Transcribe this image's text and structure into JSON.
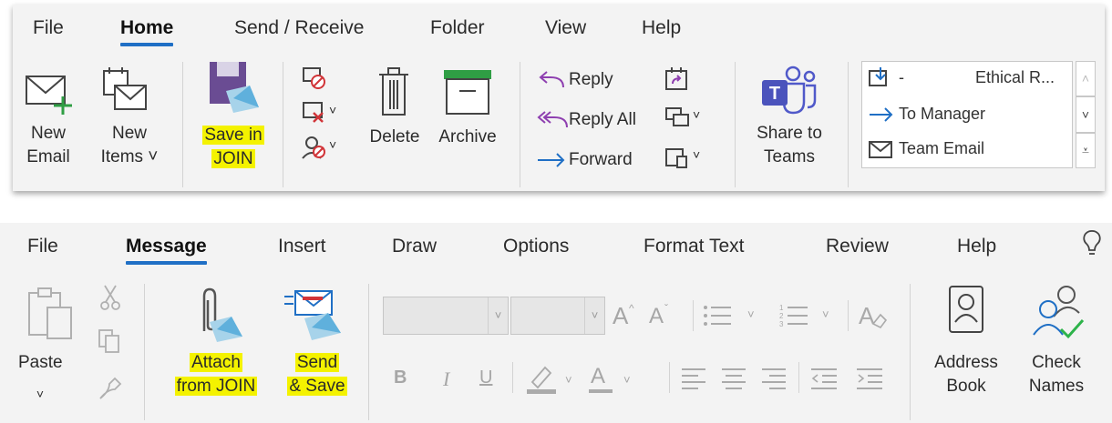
{
  "ribbon_top": {
    "tabs": [
      "File",
      "Home",
      "Send / Receive",
      "Folder",
      "View",
      "Help"
    ],
    "active_tab": "Home",
    "new_email": [
      "New",
      "Email"
    ],
    "new_items": [
      "New",
      "Items ˅"
    ],
    "save_join": [
      "Save in",
      "JOIN"
    ],
    "delete": "Delete",
    "archive": "Archive",
    "reply": "Reply",
    "reply_all": "Reply All",
    "forward": "Forward",
    "share_teams": [
      "Share to",
      "Teams"
    ],
    "quick_steps": [
      {
        "label": "-",
        "extra": "Ethical R...",
        "icon": "move-to-folder-icon"
      },
      {
        "label": "To Manager",
        "icon": "arrow-right-icon"
      },
      {
        "label": "Team Email",
        "icon": "envelope-icon"
      }
    ],
    "scroll_up": "˄",
    "scroll_down": "˅",
    "scroll_more": "⩡",
    "chevron": "˅"
  },
  "ribbon_bottom": {
    "tabs": [
      "File",
      "Message",
      "Insert",
      "Draw",
      "Options",
      "Format Text",
      "Review",
      "Help"
    ],
    "active_tab": "Message",
    "paste": "Paste",
    "paste_chevron": "˅",
    "attach_join": [
      "Attach",
      "from JOIN"
    ],
    "send_save": [
      "Send",
      "& Save"
    ],
    "address_book": [
      "Address",
      "Book"
    ],
    "check_names": [
      "Check",
      "Names"
    ],
    "bold": "B",
    "italic": "I",
    "underline": "U",
    "font_grow": "A",
    "font_shrink": "A",
    "font_color": "A",
    "chevron": "˅"
  },
  "colors": {
    "accent": "#1f6fc5",
    "highlight": "#f4f200",
    "reply_purple": "#8e3fb0",
    "forward_blue": "#1f6fc5",
    "teams_purple": "#5059c9",
    "archive_green": "#2f9e44",
    "check_green": "#2db34a"
  }
}
